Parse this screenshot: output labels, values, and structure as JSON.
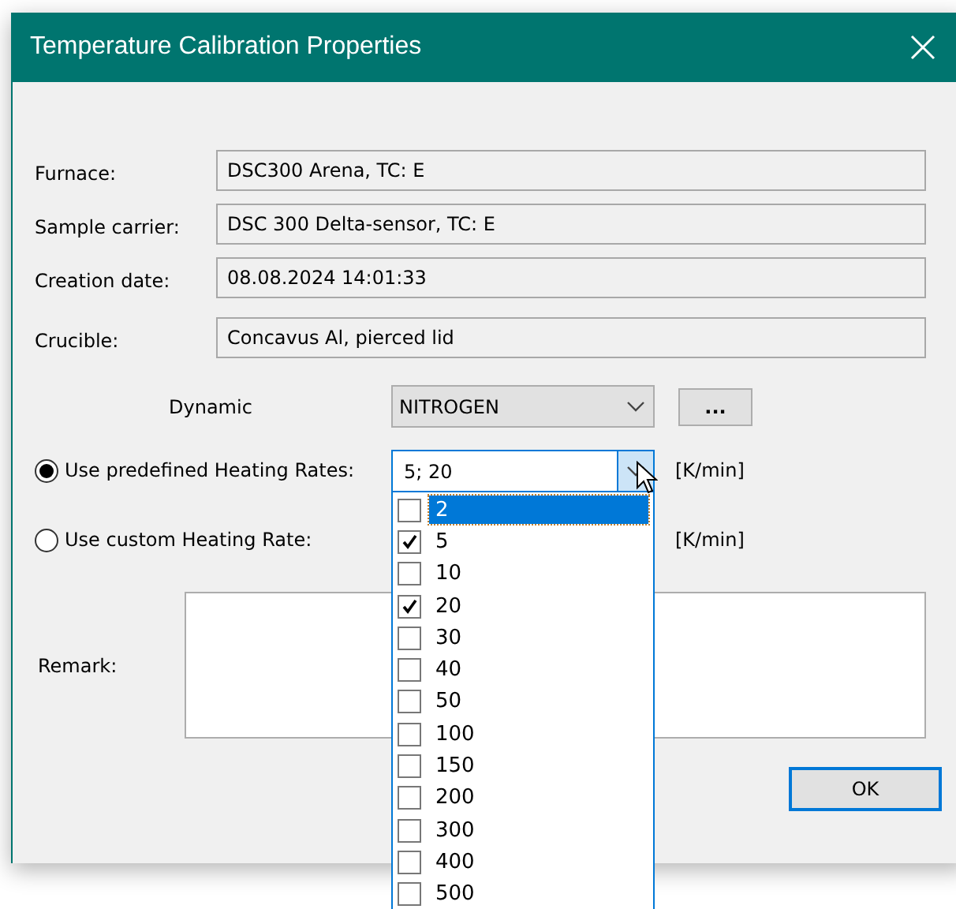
{
  "window": {
    "title": "Temperature Calibration Properties"
  },
  "fields": [
    {
      "label": "Furnace:",
      "value": "DSC300 Arena, TC: E"
    },
    {
      "label": "Sample carrier:",
      "value": "DSC 300 Delta-sensor, TC: E"
    },
    {
      "label": "Creation date:",
      "value": "08.08.2024 14:01:33"
    },
    {
      "label": "Crucible:",
      "value": "Concavus Al, pierced lid"
    }
  ],
  "gas": {
    "label": "Dynamic",
    "value": "NITROGEN",
    "button": "..."
  },
  "heating_modes": [
    {
      "label": "Use predefined Heating Rates:",
      "selected": true,
      "value": "5; 20",
      "unit": "[K/min]"
    },
    {
      "label": "Use custom Heating Rate:",
      "selected": false,
      "unit": "[K/min]"
    }
  ],
  "rates": [
    {
      "label": "2",
      "checked": false,
      "selected": true
    },
    {
      "label": "5",
      "checked": true,
      "selected": false
    },
    {
      "label": "10",
      "checked": false,
      "selected": false
    },
    {
      "label": "20",
      "checked": true,
      "selected": false
    },
    {
      "label": "30",
      "checked": false,
      "selected": false
    },
    {
      "label": "40",
      "checked": false,
      "selected": false
    },
    {
      "label": "50",
      "checked": false,
      "selected": false
    },
    {
      "label": "100",
      "checked": false,
      "selected": false
    },
    {
      "label": "150",
      "checked": false,
      "selected": false
    },
    {
      "label": "200",
      "checked": false,
      "selected": false
    },
    {
      "label": "300",
      "checked": false,
      "selected": false
    },
    {
      "label": "400",
      "checked": false,
      "selected": false
    },
    {
      "label": "500",
      "checked": false,
      "selected": false
    }
  ],
  "remark": {
    "label": "Remark:"
  },
  "buttons": [
    "OK"
  ]
}
